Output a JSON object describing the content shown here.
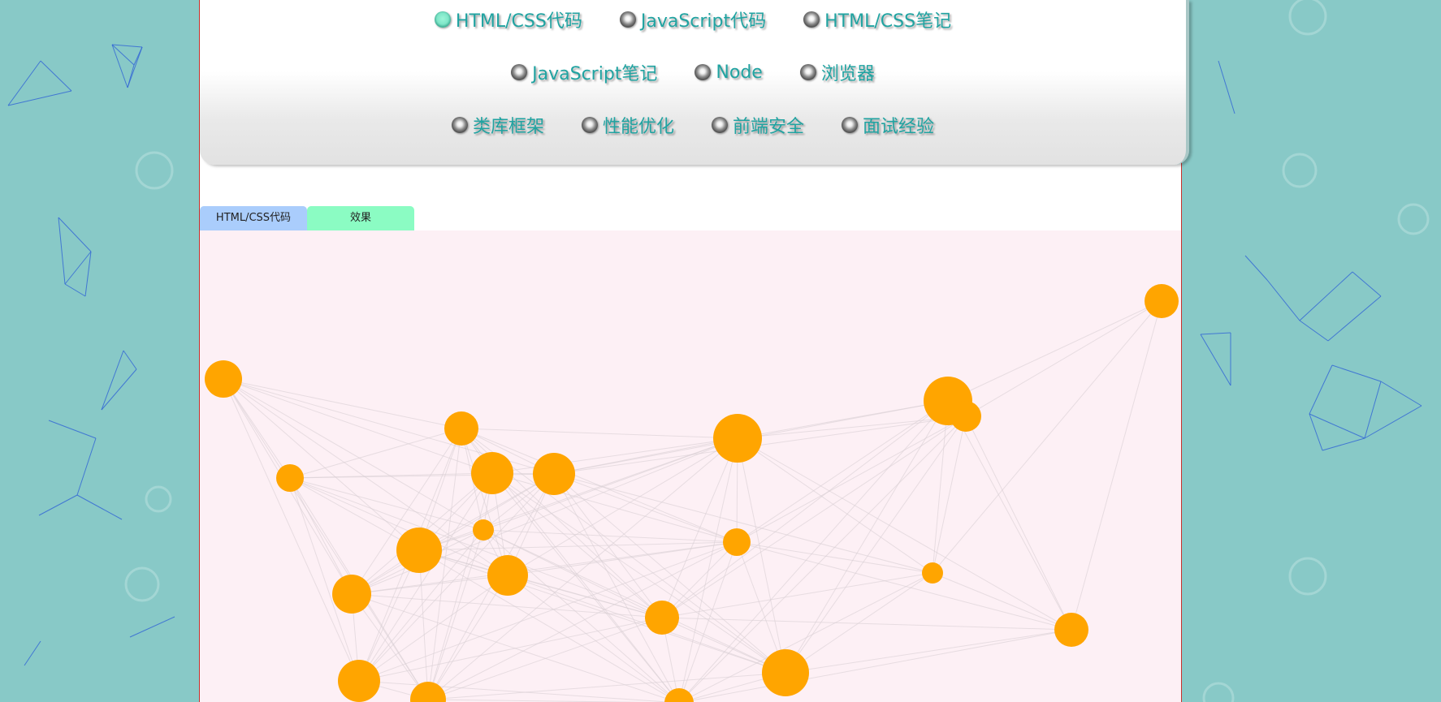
{
  "nav": {
    "rows": [
      [
        {
          "label": "HTML/CSS代码",
          "active": true
        },
        {
          "label": "JavaScript代码",
          "active": false
        },
        {
          "label": "HTML/CSS笔记",
          "active": false
        }
      ],
      [
        {
          "label": "JavaScript笔记",
          "active": false
        },
        {
          "label": "Node",
          "active": false
        },
        {
          "label": "浏览器",
          "active": false
        }
      ],
      [
        {
          "label": "类库框架",
          "active": false
        },
        {
          "label": "性能优化",
          "active": false
        },
        {
          "label": "前端安全",
          "active": false
        },
        {
          "label": "面试经验",
          "active": false
        }
      ]
    ]
  },
  "tabs": {
    "code_label": "HTML/CSS代码",
    "effect_label": "效果"
  },
  "colors": {
    "background": "#88c9c7",
    "accent_text": "#20a3a1",
    "bubble": "#ffa500",
    "canvas": "#fdf0f5",
    "tab_code": "#aacdfc",
    "tab_effect": "#8bfcc3"
  }
}
